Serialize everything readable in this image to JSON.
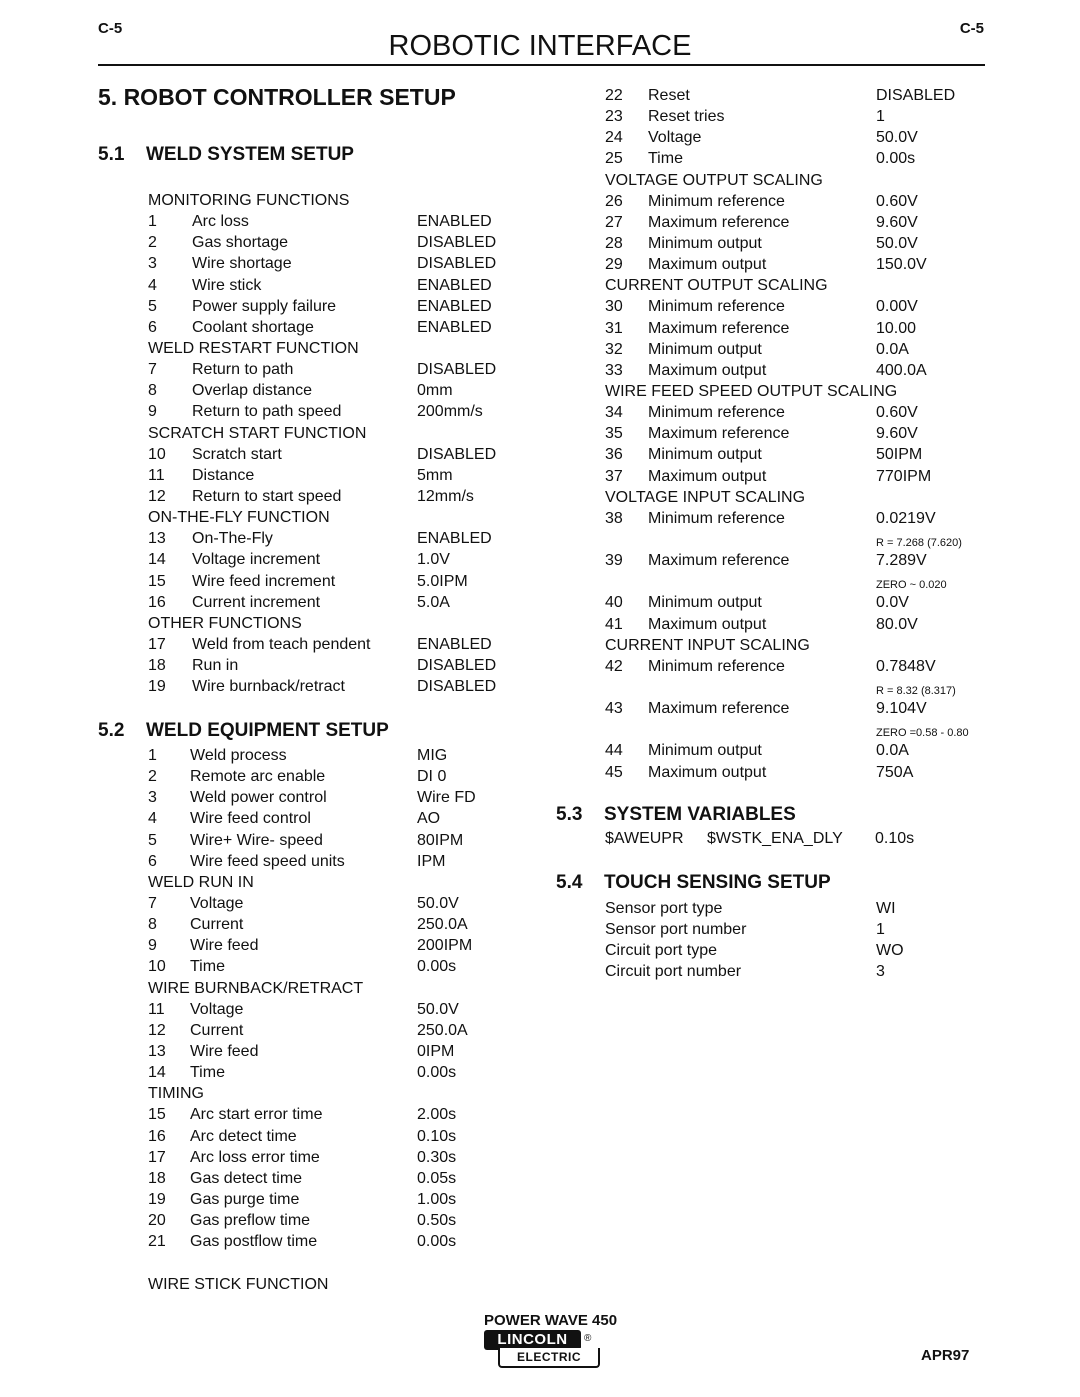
{
  "header": {
    "page_code_left": "C-5",
    "page_code_right": "C-5",
    "title": "ROBOTIC INTERFACE"
  },
  "main_title": "5. ROBOT CONTROLLER SETUP",
  "sections": {
    "s51": {
      "num": "5.1",
      "title": "WELD SYSTEM SETUP"
    },
    "s52": {
      "num": "5.2",
      "title": "WELD EQUIPMENT SETUP"
    },
    "s53": {
      "num": "5.3",
      "title": "SYSTEM VARIABLES"
    },
    "s54": {
      "num": "5.4",
      "title": "TOUCH SENSING SETUP"
    }
  },
  "weld_system": [
    {
      "type": "cat",
      "text": "MONITORING FUNCTIONS"
    },
    {
      "n": "1",
      "label": "Arc loss",
      "value": "ENABLED"
    },
    {
      "n": "2",
      "label": "Gas shortage",
      "value": "DISABLED"
    },
    {
      "n": "3",
      "label": "Wire shortage",
      "value": "DISABLED"
    },
    {
      "n": "4",
      "label": "Wire stick",
      "value": "ENABLED"
    },
    {
      "n": "5",
      "label": "Power supply failure",
      "value": "ENABLED"
    },
    {
      "n": "6",
      "label": "Coolant shortage",
      "value": "ENABLED"
    },
    {
      "type": "cat",
      "text": "WELD RESTART FUNCTION"
    },
    {
      "n": "7",
      "label": "Return to path",
      "value": "DISABLED"
    },
    {
      "n": "8",
      "label": "Overlap distance",
      "value": "0mm"
    },
    {
      "n": "9",
      "label": "Return to path speed",
      "value": "200mm/s"
    },
    {
      "type": "cat",
      "text": "SCRATCH START FUNCTION"
    },
    {
      "n": "10",
      "label": "Scratch start",
      "value": "DISABLED"
    },
    {
      "n": "11",
      "label": "Distance",
      "value": "5mm"
    },
    {
      "n": "12",
      "label": "Return to start speed",
      "value": "12mm/s"
    },
    {
      "type": "cat",
      "text": "ON-THE-FLY FUNCTION"
    },
    {
      "n": "13",
      "label": "On-The-Fly",
      "value": "ENABLED"
    },
    {
      "n": "14",
      "label": "Voltage increment",
      "value": "1.0V"
    },
    {
      "n": "15",
      "label": "Wire feed increment",
      "value": "5.0IPM"
    },
    {
      "n": "16",
      "label": "Current increment",
      "value": "5.0A"
    },
    {
      "type": "cat",
      "text": "OTHER FUNCTIONS"
    },
    {
      "n": "17",
      "label": "Weld from teach pendent",
      "value": "ENABLED"
    },
    {
      "n": "18",
      "label": "Run in",
      "value": "DISABLED"
    },
    {
      "n": "19",
      "label": "Wire burnback/retract",
      "value": "DISABLED"
    }
  ],
  "weld_equipment": [
    {
      "n": "1",
      "label": "Weld process",
      "value": "MIG"
    },
    {
      "n": "2",
      "label": "Remote arc enable",
      "value": "DI 0"
    },
    {
      "n": "3",
      "label": "Weld power control",
      "value": "Wire FD"
    },
    {
      "n": "4",
      "label": "Wire feed control",
      "value": "AO"
    },
    {
      "n": "5",
      "label": "Wire+ Wire- speed",
      "value": "80IPM"
    },
    {
      "n": "6",
      "label": "Wire feed speed units",
      "value": "IPM"
    },
    {
      "type": "cat",
      "text": "WELD RUN IN"
    },
    {
      "n": "7",
      "label": "Voltage",
      "value": "50.0V"
    },
    {
      "n": "8",
      "label": "Current",
      "value": "250.0A"
    },
    {
      "n": "9",
      "label": "Wire feed",
      "value": "200IPM"
    },
    {
      "n": "10",
      "label": "Time",
      "value": "0.00s"
    },
    {
      "type": "cat",
      "text": "WIRE BURNBACK/RETRACT"
    },
    {
      "n": "11",
      "label": "Voltage",
      "value": "50.0V"
    },
    {
      "n": "12",
      "label": "Current",
      "value": "250.0A"
    },
    {
      "n": "13",
      "label": "Wire feed",
      "value": "0IPM"
    },
    {
      "n": "14",
      "label": "Time",
      "value": "0.00s"
    },
    {
      "type": "cat",
      "text": "TIMING"
    },
    {
      "n": "15",
      "label": "Arc start error time",
      "value": "2.00s"
    },
    {
      "n": "16",
      "label": "Arc detect time",
      "value": "0.10s"
    },
    {
      "n": "17",
      "label": "Arc loss error time",
      "value": "0.30s"
    },
    {
      "n": "18",
      "label": "Gas detect time",
      "value": "0.05s"
    },
    {
      "n": "19",
      "label": "Gas purge time",
      "value": "1.00s"
    },
    {
      "n": "20",
      "label": "Gas preflow time",
      "value": "0.50s"
    },
    {
      "n": "21",
      "label": "Gas postflow time",
      "value": "0.00s"
    },
    {
      "type": "spacer"
    },
    {
      "type": "cat",
      "text": "WIRE STICK FUNCTION"
    }
  ],
  "weld_equipment_cont": [
    {
      "n": "22",
      "label": "Reset",
      "value": "DISABLED"
    },
    {
      "n": "23",
      "label": "Reset tries",
      "value": "1"
    },
    {
      "n": "24",
      "label": "Voltage",
      "value": "50.0V"
    },
    {
      "n": "25",
      "label": "Time",
      "value": "0.00s"
    },
    {
      "type": "cat",
      "text": "VOLTAGE OUTPUT SCALING"
    },
    {
      "n": "26",
      "label": "Minimum reference",
      "value": "0.60V"
    },
    {
      "n": "27",
      "label": "Maximum reference",
      "value": "9.60V"
    },
    {
      "n": "28",
      "label": "Minimum output",
      "value": "50.0V"
    },
    {
      "n": "29",
      "label": "Maximum output",
      "value": "150.0V"
    },
    {
      "type": "cat",
      "text": "CURRENT OUTPUT SCALING"
    },
    {
      "n": "30",
      "label": "Minimum reference",
      "value": "0.00V"
    },
    {
      "n": "31",
      "label": "Maximum reference",
      "value": "10.00"
    },
    {
      "n": "32",
      "label": "Minimum output",
      "value": "0.0A"
    },
    {
      "n": "33",
      "label": "Maximum output",
      "value": "400.0A"
    },
    {
      "type": "cat",
      "text": "WIRE FEED SPEED OUTPUT SCALING"
    },
    {
      "n": "34",
      "label": "Minimum reference",
      "value": "0.60V"
    },
    {
      "n": "35",
      "label": "Maximum reference",
      "value": "9.60V"
    },
    {
      "n": "36",
      "label": "Minimum output",
      "value": "50IPM"
    },
    {
      "n": "37",
      "label": "Maximum output",
      "value": "770IPM"
    },
    {
      "type": "cat",
      "text": "VOLTAGE INPUT SCALING"
    },
    {
      "n": "38",
      "label": "Minimum reference",
      "value": "0.0219V"
    },
    {
      "type": "note",
      "value": "R = 7.268 (7.620)"
    },
    {
      "n": "39",
      "label": "Maximum reference",
      "value": "7.289V"
    },
    {
      "type": "note",
      "value": "ZERO ~ 0.020"
    },
    {
      "n": "40",
      "label": "Minimum output",
      "value": "0.0V"
    },
    {
      "n": "41",
      "label": "Maximum output",
      "value": "80.0V"
    },
    {
      "type": "cat",
      "text": "CURRENT INPUT SCALING"
    },
    {
      "n": "42",
      "label": "Minimum reference",
      "value": "0.7848V"
    },
    {
      "type": "note",
      "value": "R = 8.32 (8.317)"
    },
    {
      "n": "43",
      "label": "Maximum reference",
      "value": "9.104V"
    },
    {
      "type": "note",
      "value": "ZERO =0.58 - 0.80"
    },
    {
      "n": "44",
      "label": "Minimum output",
      "value": "0.0A"
    },
    {
      "n": "45",
      "label": "Maximum output",
      "value": "750A"
    }
  ],
  "system_variables": {
    "var1": "$AWEUPR",
    "var2": "$WSTK_ENA_DLY",
    "value": "0.10s"
  },
  "touch_sensing": [
    {
      "label": "Sensor port type",
      "value": "WI"
    },
    {
      "label": "Sensor port number",
      "value": "1"
    },
    {
      "label": "Circuit port type",
      "value": "WO"
    },
    {
      "label": "Circuit port number",
      "value": "3"
    }
  ],
  "footer": {
    "product": "POWER WAVE 450",
    "logo_top": "LINCOLN",
    "logo_bottom": "ELECTRIC",
    "logo_reg": "®",
    "date": "APR97"
  }
}
